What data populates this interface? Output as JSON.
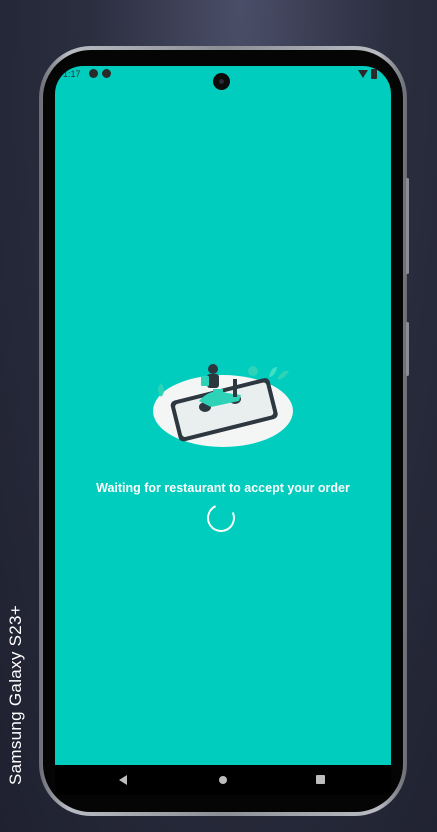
{
  "device": {
    "label": "Samsung Galaxy  S23+"
  },
  "status_bar": {
    "time": "1:17",
    "icons": [
      "notification-icon",
      "app-icon",
      "wifi-icon",
      "battery-icon"
    ]
  },
  "colors": {
    "screen_background": "#00cdbd",
    "illustration_accent": "#2ed3b7",
    "text": "#ffffff"
  },
  "main": {
    "illustration": "scooter-delivery-illustration",
    "status_message": "Waiting for restaurant to accept your order",
    "loading_indicator": "spinner"
  },
  "navigation_bar": {
    "buttons": [
      "back",
      "home",
      "recents"
    ]
  }
}
